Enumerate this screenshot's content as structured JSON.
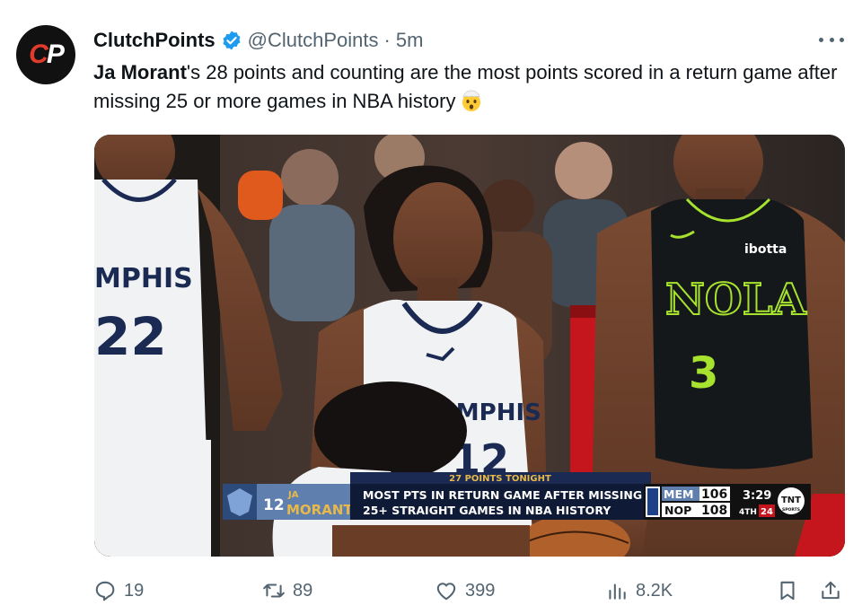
{
  "author": {
    "display_name": "ClutchPoints",
    "handle": "@ClutchPoints",
    "separator": "·",
    "timestamp": "5m",
    "avatar_text_c": "C",
    "avatar_text_p": "P",
    "verified_color": "#1d9bf0"
  },
  "tweet": {
    "name_bold": "Ja Morant",
    "text": "'s 28 points and counting are the most points scored in a return game after missing 25 or more games in NBA history",
    "emoji": "exploding-head-emoji"
  },
  "media": {
    "jersey_left_text": "MPHIS",
    "jersey_left_number": "22",
    "jersey_center_text": "EMPHIS",
    "jersey_center_number": "12",
    "jersey_right_text": "NOLA",
    "jersey_right_number": "3",
    "jersey_right_sponsor": "ibotta",
    "chyron": {
      "header": "27 POINTS TONIGHT",
      "player_number": "12",
      "player_first": "JA",
      "player_last": "MORANT",
      "line1": "MOST PTS IN RETURN GAME AFTER MISSING",
      "line2": "25+ STRAIGHT GAMES IN NBA HISTORY",
      "team1": "MEM",
      "score1": "106",
      "team2": "NOP",
      "score2": "108",
      "clock": "3:29",
      "quarter": "4TH",
      "shot_clock": "24",
      "network": "TNT",
      "network_sub": "SPORTS"
    }
  },
  "actions": {
    "replies": "19",
    "retweets": "89",
    "likes": "399",
    "views": "8.2K"
  }
}
